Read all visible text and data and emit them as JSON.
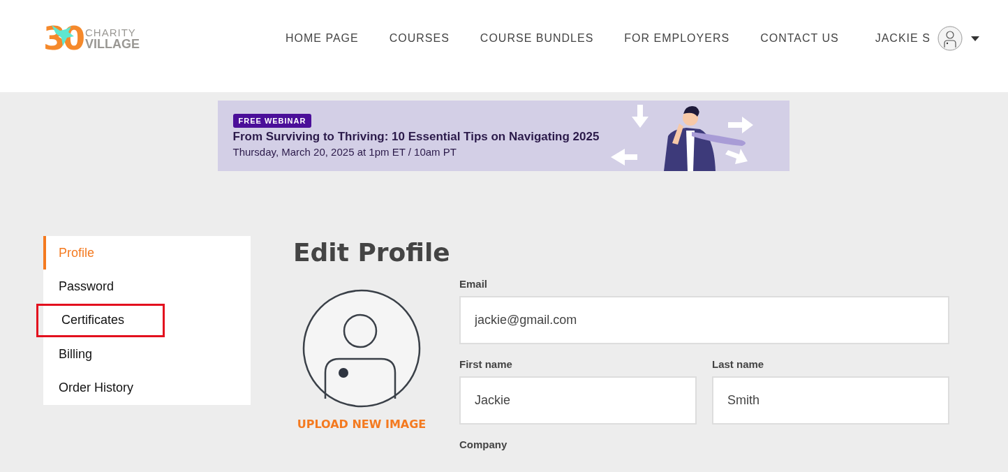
{
  "logo": {
    "number": "30",
    "line_1": "CHARITY",
    "line_2": "VILLAGE"
  },
  "nav": [
    {
      "label": "HOME PAGE"
    },
    {
      "label": "COURSES"
    },
    {
      "label": "COURSE BUNDLES"
    },
    {
      "label": "FOR EMPLOYERS"
    },
    {
      "label": "CONTACT US"
    }
  ],
  "user_menu": {
    "name": "JACKIE S"
  },
  "banner": {
    "badge": "FREE WEBINAR",
    "title": "From Surviving to Thriving: 10 Essential Tips on Navigating 2025",
    "date": "Thursday, March 20, 2025 at 1pm ET / 10am PT"
  },
  "sidebar": {
    "items": [
      {
        "label": "Profile",
        "selected": true,
        "highlighted": false
      },
      {
        "label": "Password",
        "selected": false,
        "highlighted": false
      },
      {
        "label": "Certificates",
        "selected": false,
        "highlighted": true
      },
      {
        "label": "Billing",
        "selected": false,
        "highlighted": false
      },
      {
        "label": "Order History",
        "selected": false,
        "highlighted": false
      }
    ]
  },
  "heading": "Edit Profile",
  "upload_link": "UPLOAD NEW IMAGE",
  "form": {
    "email": {
      "label": "Email",
      "value": "jackie@gmail.com"
    },
    "first_name": {
      "label": "First name",
      "value": "Jackie"
    },
    "last_name": {
      "label": "Last name",
      "value": "Smith"
    },
    "company": {
      "label": "Company"
    }
  }
}
